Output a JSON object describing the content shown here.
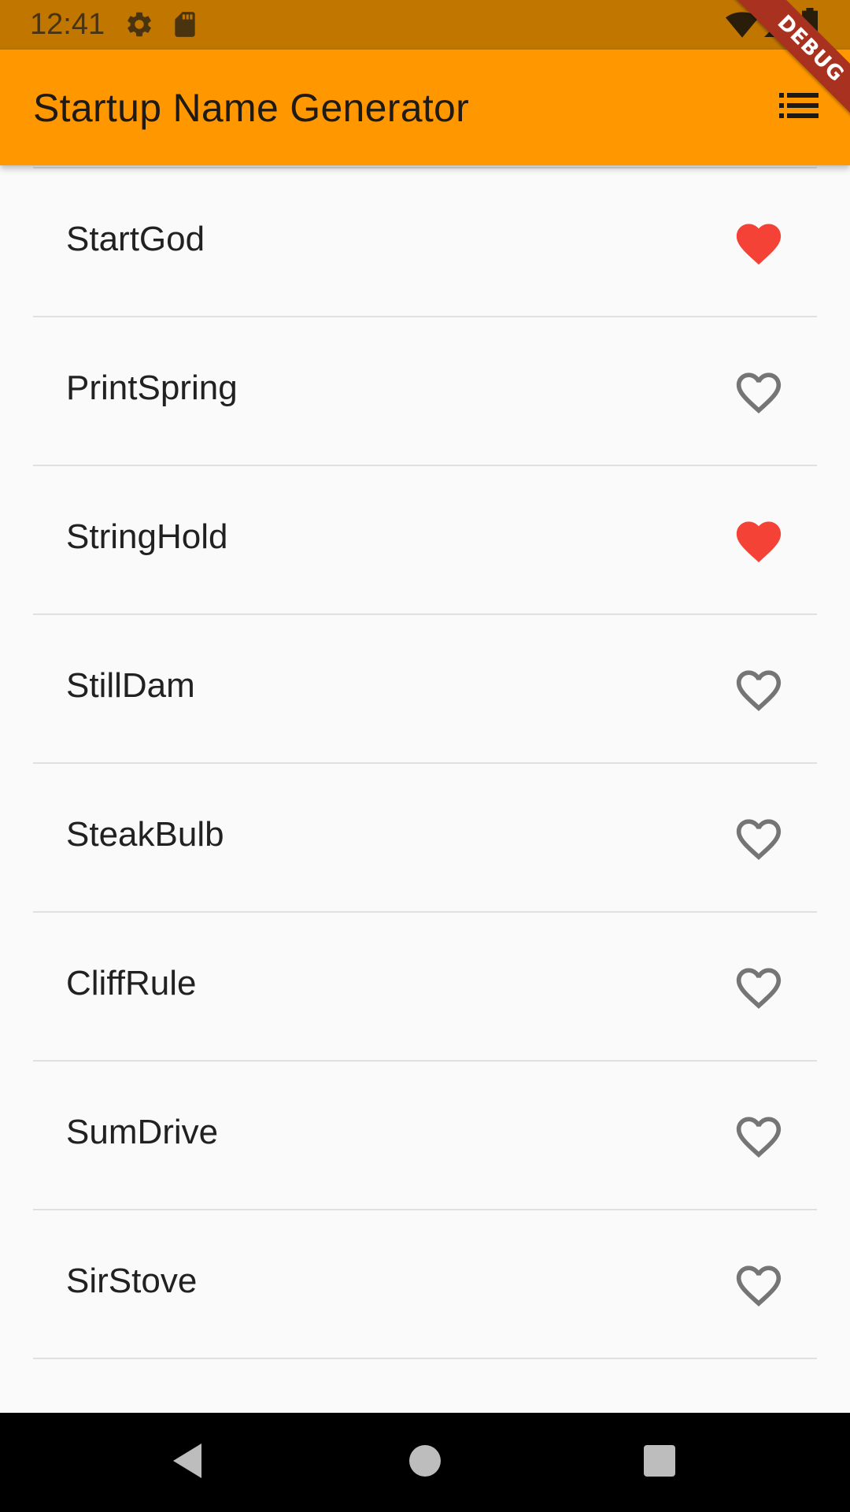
{
  "status_bar": {
    "time": "12:41",
    "left_icons": [
      "gear-icon",
      "sd-card-icon"
    ],
    "right_icons": [
      "wifi-icon",
      "signal-icon",
      "battery-icon"
    ]
  },
  "debug_banner": {
    "label": "DEBUG"
  },
  "app_bar": {
    "title": "Startup Name Generator",
    "action_icon": "list-icon",
    "color": "#ff9800"
  },
  "list": {
    "items": [
      {
        "label": "StartGod",
        "favorited": true
      },
      {
        "label": "PrintSpring",
        "favorited": false
      },
      {
        "label": "StringHold",
        "favorited": true
      },
      {
        "label": "StillDam",
        "favorited": false
      },
      {
        "label": "SteakBulb",
        "favorited": false
      },
      {
        "label": "CliffRule",
        "favorited": false
      },
      {
        "label": "SumDrive",
        "favorited": false
      },
      {
        "label": "SirStove",
        "favorited": false
      }
    ],
    "favorite_color": "#f44336",
    "unfavorite_color": "#757575"
  },
  "nav_bar": {
    "buttons": [
      "back-icon",
      "home-icon",
      "recents-icon"
    ]
  }
}
